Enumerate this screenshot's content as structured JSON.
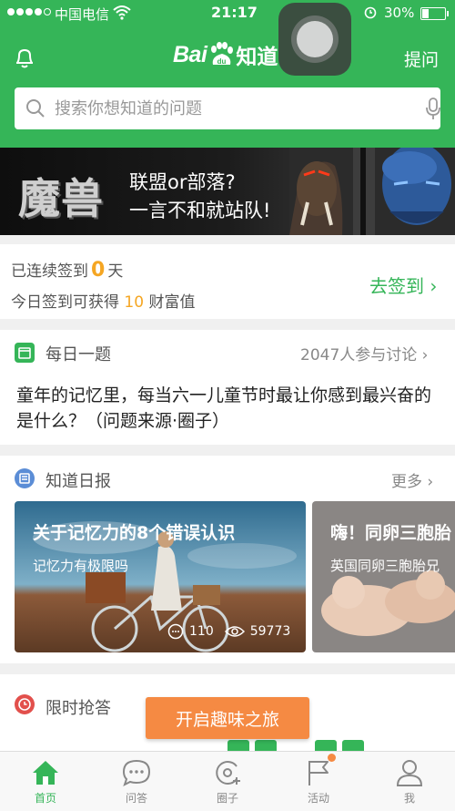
{
  "status_bar": {
    "carrier": "中国电信",
    "time": "21:17",
    "battery": "30%",
    "battery_level": 0.3
  },
  "header": {
    "logo_latin": "Bai",
    "logo_paw_text": "du",
    "logo_cn": "知道",
    "ask_label": "提问"
  },
  "search": {
    "placeholder": "搜索你想知道的问题"
  },
  "banner": {
    "title": "魔兽",
    "line1": "联盟or部落?",
    "line2": "一言不和就站队!"
  },
  "checkin": {
    "streak_prefix": "已连续签到",
    "streak_days": "0",
    "streak_suffix": "天",
    "reward_prefix": "今日签到可获得",
    "reward_amount": "10",
    "reward_suffix": "财富值",
    "signin_label": "去签到 ›"
  },
  "daily_question": {
    "label": "每日一题",
    "participants": "2047人参与讨论 ›",
    "question": "童年的记忆里，每当六一儿童节时最让你感到最兴奋的是什么？（问题来源·圈子）"
  },
  "daily_report": {
    "label": "知道日报",
    "more_label": "更多 ›",
    "articles": [
      {
        "title": "关于记忆力的8个错误认识",
        "subtitle": "记忆力有极限吗",
        "comments": "110",
        "views": "59773"
      },
      {
        "title": "嗨！同卵三胞胎",
        "subtitle": "英国同卵三胞胎兄"
      }
    ]
  },
  "flash_answer": {
    "label": "限时抢答",
    "cta": "开启趣味之旅"
  },
  "tabbar": {
    "tabs": [
      {
        "label": "首页",
        "icon": "home-icon"
      },
      {
        "label": "问答",
        "icon": "chat-icon"
      },
      {
        "label": "圈子",
        "icon": "circle-add-icon"
      },
      {
        "label": "活动",
        "icon": "flag-icon"
      },
      {
        "label": "我",
        "icon": "person-icon"
      }
    ]
  },
  "colors": {
    "brand_green": "#35b558",
    "accent_orange": "#f5a623",
    "cta_orange": "#f58a43"
  }
}
